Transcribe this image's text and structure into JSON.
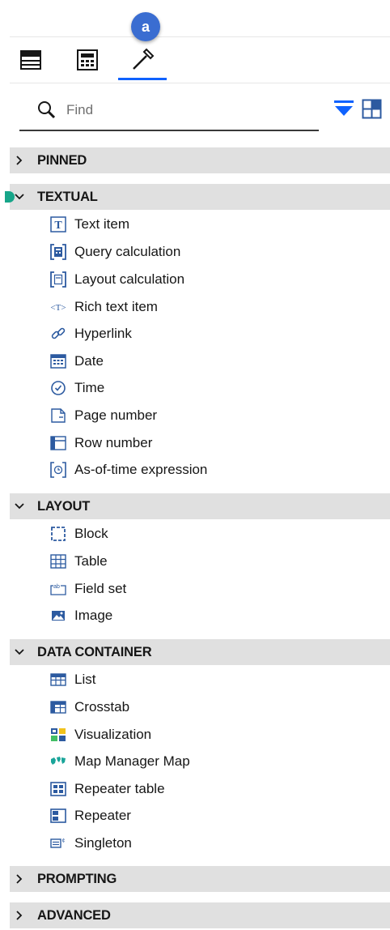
{
  "badge": {
    "label": "a"
  },
  "tabs": [
    {
      "icon": "page-layers-icon"
    },
    {
      "icon": "data-items-icon"
    },
    {
      "icon": "toolbox-icon",
      "active": true
    }
  ],
  "search": {
    "placeholder": "Find",
    "value": ""
  },
  "toolbar": {
    "filter_icon": "filter-icon",
    "layout_icon": "view-layout-icon"
  },
  "sections": {
    "pinned": {
      "title": "PINNED",
      "expanded": false
    },
    "textual": {
      "title": "TEXTUAL",
      "expanded": true,
      "items": [
        {
          "label": "Text item",
          "icon": "text-item-icon"
        },
        {
          "label": "Query calculation",
          "icon": "query-calculation-icon"
        },
        {
          "label": "Layout calculation",
          "icon": "layout-calculation-icon"
        },
        {
          "label": "Rich text item",
          "icon": "rich-text-icon"
        },
        {
          "label": "Hyperlink",
          "icon": "hyperlink-icon"
        },
        {
          "label": "Date",
          "icon": "date-icon"
        },
        {
          "label": "Time",
          "icon": "time-icon"
        },
        {
          "label": "Page number",
          "icon": "page-number-icon"
        },
        {
          "label": "Row number",
          "icon": "row-number-icon"
        },
        {
          "label": "As-of-time expression",
          "icon": "as-of-time-icon"
        }
      ]
    },
    "layout": {
      "title": "LAYOUT",
      "expanded": true,
      "items": [
        {
          "label": "Block",
          "icon": "block-icon"
        },
        {
          "label": "Table",
          "icon": "table-icon"
        },
        {
          "label": "Field set",
          "icon": "field-set-icon"
        },
        {
          "label": "Image",
          "icon": "image-icon"
        }
      ]
    },
    "data_container": {
      "title": "DATA CONTAINER",
      "expanded": true,
      "items": [
        {
          "label": "List",
          "icon": "list-icon"
        },
        {
          "label": "Crosstab",
          "icon": "crosstab-icon"
        },
        {
          "label": "Visualization",
          "icon": "visualization-icon"
        },
        {
          "label": "Map Manager Map",
          "icon": "map-icon"
        },
        {
          "label": "Repeater table",
          "icon": "repeater-table-icon"
        },
        {
          "label": "Repeater",
          "icon": "repeater-icon"
        },
        {
          "label": "Singleton",
          "icon": "singleton-icon"
        }
      ]
    },
    "prompting": {
      "title": "PROMPTING",
      "expanded": false
    },
    "advanced": {
      "title": "ADVANCED",
      "expanded": false
    }
  },
  "colors": {
    "accent": "#0f62fe",
    "badge": "#3a6dd1",
    "section_bg": "#e0e0e0",
    "icon": "#2c5aa0"
  }
}
